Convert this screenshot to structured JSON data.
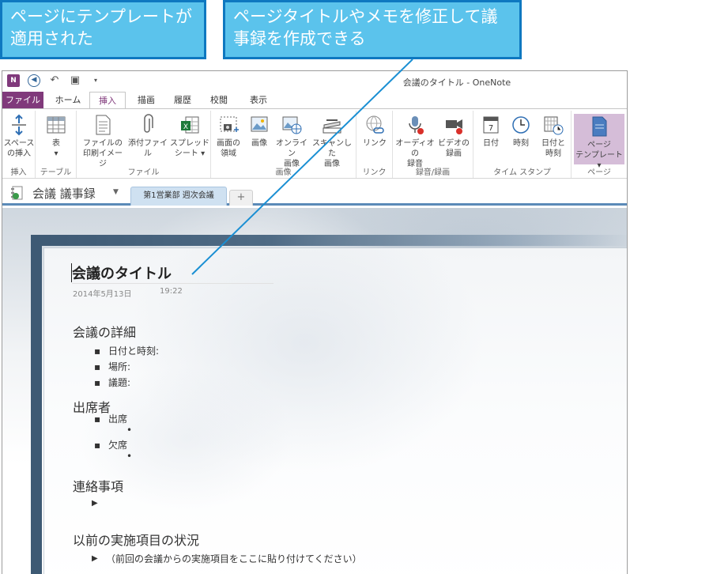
{
  "callouts": {
    "left": "ページにテンプレートが適用された",
    "right": "ページタイトルやメモを修正して議事録を作成できる"
  },
  "window": {
    "title": "会議のタイトル - OneNote",
    "logo_text": "N"
  },
  "tabs": [
    "ファイル",
    "ホーム",
    "挿入",
    "描画",
    "履歴",
    "校閲",
    "表示"
  ],
  "active_tab": "挿入",
  "ribbon": {
    "groups": [
      {
        "label": "挿入",
        "buttons": [
          {
            "label1": "スペース",
            "label2": "の挿入",
            "icon": "insert-space-icon"
          }
        ]
      },
      {
        "label": "テーブル",
        "buttons": [
          {
            "label1": "表",
            "label2": "▾",
            "icon": "table-icon"
          }
        ]
      },
      {
        "label": "ファイル",
        "buttons": [
          {
            "label1": "ファイルの",
            "label2": "印刷イメージ",
            "icon": "file-printout-icon"
          },
          {
            "label1": "添付ファイル",
            "label2": "",
            "icon": "paperclip-icon"
          },
          {
            "label1": "スプレッド",
            "label2": "シート ▾",
            "icon": "spreadsheet-icon"
          }
        ]
      },
      {
        "label": "画像",
        "buttons": [
          {
            "label1": "画面の",
            "label2": "領域",
            "icon": "screen-clipping-icon"
          },
          {
            "label1": "画像",
            "label2": "",
            "icon": "picture-icon"
          },
          {
            "label1": "オンライン",
            "label2": "画像",
            "icon": "online-picture-icon"
          },
          {
            "label1": "スキャンした",
            "label2": "画像",
            "icon": "scanner-icon"
          }
        ]
      },
      {
        "label": "リンク",
        "buttons": [
          {
            "label1": "リンク",
            "label2": "",
            "icon": "link-icon"
          }
        ]
      },
      {
        "label": "録音/録画",
        "buttons": [
          {
            "label1": "オーディオの",
            "label2": "録音",
            "icon": "microphone-icon"
          },
          {
            "label1": "ビデオの",
            "label2": "録画",
            "icon": "video-camera-icon"
          }
        ]
      },
      {
        "label": "タイム スタンプ",
        "buttons": [
          {
            "label1": "日付",
            "label2": "",
            "icon": "calendar-icon"
          },
          {
            "label1": "時刻",
            "label2": "",
            "icon": "clock-icon"
          },
          {
            "label1": "日付と",
            "label2": "時刻",
            "icon": "date-time-icon"
          }
        ]
      },
      {
        "label": "ページ",
        "buttons": [
          {
            "label1": "ページ",
            "label2": "テンプレート ▾",
            "icon": "page-template-icon"
          }
        ]
      }
    ]
  },
  "notebook": {
    "name": "会議 議事録",
    "section_tab": "第1営業部 週次会議",
    "add_tab": "+"
  },
  "page": {
    "title": "会議のタイトル",
    "date": "2014年5月13日",
    "time": "19:22",
    "sections": {
      "details_heading": "会議の詳細",
      "details_items": [
        "日付と時刻:",
        "場所:",
        "議題:"
      ],
      "attendees_heading": "出席者",
      "attendees_items": [
        "出席",
        "欠席"
      ],
      "contacts_heading": "連絡事項",
      "previous_heading": "以前の実施項目の状況",
      "previous_item": "（前回の会議からの実施項目をここに貼り付けてください）"
    }
  },
  "colors": {
    "callout_fill": "#5bc3ec",
    "callout_border": "#0e78c0",
    "onenote_purple": "#80397b",
    "section_tab": "#cfe1f1",
    "connector": "#1a8fd3"
  }
}
